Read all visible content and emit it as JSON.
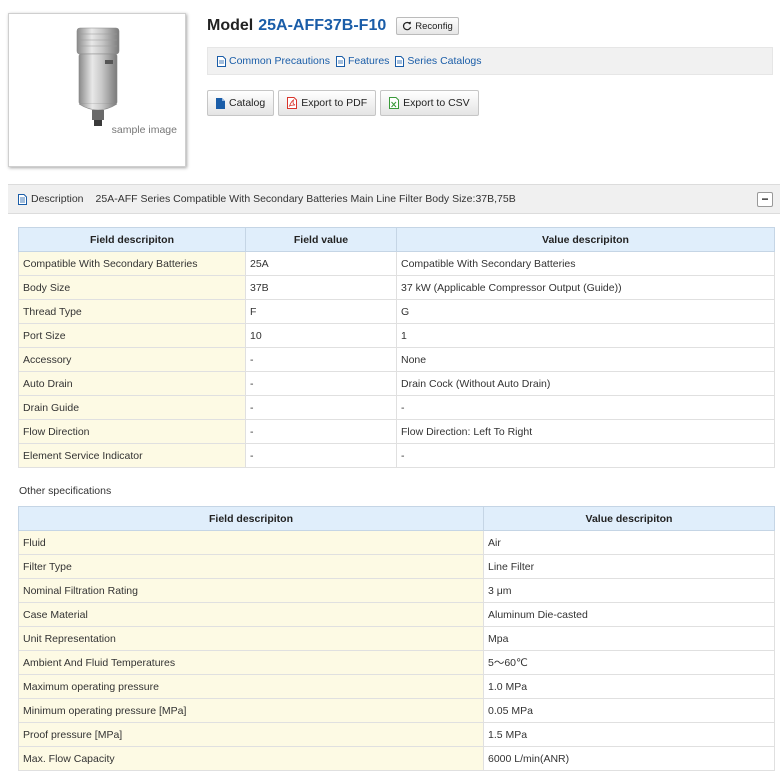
{
  "product": {
    "sample_label": "sample image"
  },
  "header": {
    "model_prefix": "Model",
    "model_number": "25A-AFF37B-F10",
    "reconfig_label": "Reconfig"
  },
  "links": [
    {
      "label": "Common Precautions",
      "icon": "document-icon"
    },
    {
      "label": "Features",
      "icon": "document-icon"
    },
    {
      "label": "Series Catalogs",
      "icon": "document-icon"
    }
  ],
  "buttons": {
    "catalog": "Catalog",
    "pdf": "Export to PDF",
    "csv": "Export to CSV"
  },
  "description": {
    "label": "Description",
    "text": "25A-AFF Series Compatible With Secondary Batteries Main Line Filter Body Size:37B,75B",
    "collapse_symbol": "−"
  },
  "main_table": {
    "headers": [
      "Field descripiton",
      "Field value",
      "Value descripiton"
    ],
    "rows": [
      [
        "Compatible With Secondary Batteries",
        "25A",
        "Compatible With Secondary Batteries"
      ],
      [
        "Body Size",
        "37B",
        "37 kW (Applicable Compressor Output (Guide))"
      ],
      [
        "Thread Type",
        "F",
        "G"
      ],
      [
        "Port Size",
        "10",
        "1"
      ],
      [
        "Accessory",
        "-",
        "None"
      ],
      [
        "Auto Drain",
        "-",
        "Drain Cock (Without Auto Drain)"
      ],
      [
        "Drain Guide",
        "-",
        "-"
      ],
      [
        "Flow Direction",
        "-",
        "Flow Direction: Left To Right"
      ],
      [
        "Element Service Indicator",
        "-",
        "-"
      ]
    ]
  },
  "other_specs": {
    "title": "Other specifications",
    "headers": [
      "Field descripiton",
      "Value descripiton"
    ],
    "rows": [
      [
        "Fluid",
        "Air"
      ],
      [
        "Filter Type",
        "Line Filter"
      ],
      [
        "Nominal Filtration Rating",
        "3 μm"
      ],
      [
        "Case Material",
        "Aluminum Die-casted"
      ],
      [
        "Unit Representation",
        "Mpa"
      ],
      [
        "Ambient And Fluid Temperatures",
        "5～60℃"
      ],
      [
        "Maximum operating pressure",
        "1.0 MPa"
      ],
      [
        "Minimum operating pressure [MPa]",
        "0.05 MPa"
      ],
      [
        "Proof pressure [MPa]",
        "1.5 MPa"
      ],
      [
        "Max. Flow Capacity",
        "6000 L/min(ANR)"
      ]
    ]
  },
  "colors": {
    "link": "#1a5da8",
    "header_bg": "#e0eefb",
    "field_bg": "#fdfae4",
    "pdf_icon": "#d9342b",
    "csv_icon": "#3a9a3a"
  }
}
